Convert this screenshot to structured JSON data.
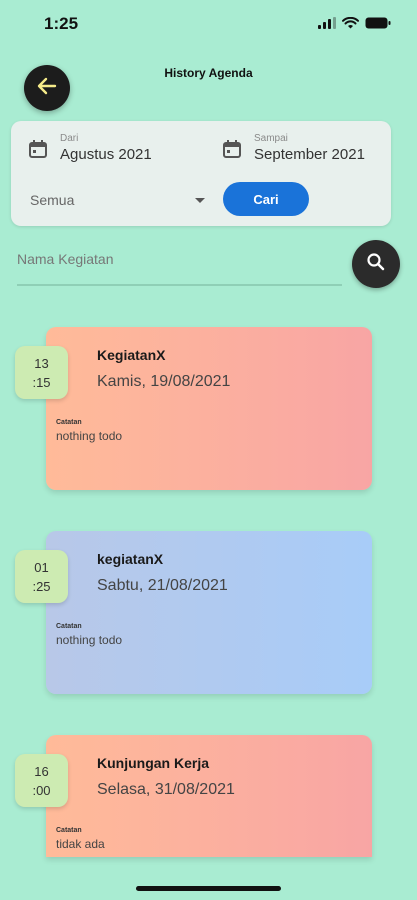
{
  "status_bar": {
    "time": "1:25"
  },
  "header": {
    "title": "History Agenda"
  },
  "filter": {
    "from": {
      "label": "Dari",
      "value": "Agustus 2021"
    },
    "to": {
      "label": "Sampai",
      "value": "September 2021"
    },
    "category_select": {
      "value": "Semua"
    },
    "search_button": "Cari"
  },
  "search": {
    "placeholder": "Nama Kegiatan"
  },
  "agenda_items": [
    {
      "time_hour": "13",
      "time_minute": ":15",
      "title": "KegiatanX",
      "date": "Kamis, 19/08/2021",
      "note_label": "Catatan",
      "note": "nothing todo",
      "color_scheme": "warm"
    },
    {
      "time_hour": "01",
      "time_minute": ":25",
      "title": "kegiatanX",
      "date": "Sabtu, 21/08/2021",
      "note_label": "Catatan",
      "note": "nothing todo",
      "color_scheme": "cool"
    },
    {
      "time_hour": "16",
      "time_minute": ":00",
      "title": "Kunjungan Kerja",
      "date": "Selasa, 31/08/2021",
      "note_label": "Catatan",
      "note": "tidak ada",
      "color_scheme": "warm"
    }
  ],
  "colors": {
    "background": "#a9ecd2",
    "accent_blue": "#1a73d9",
    "badge_green": "#cdebb2",
    "card_warm_start": "#ffbb99",
    "card_warm_end": "#f8a5a4",
    "card_cool_start": "#b8c8e8",
    "card_cool_end": "#a8ccf8"
  }
}
